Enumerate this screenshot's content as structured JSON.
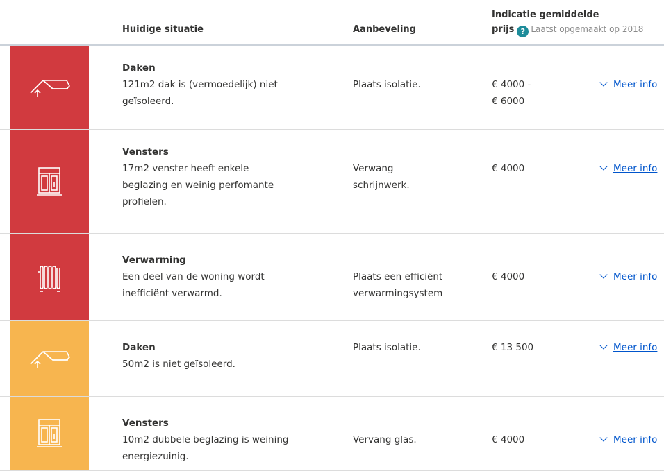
{
  "header": {
    "situatie": "Huidige situatie",
    "aanbeveling": "Aanbeveling",
    "prijs_line1": "Indicatie gemiddelde",
    "prijs_line2": "prijs",
    "help_glyph": "?",
    "updated": "Laatst opgemaakt op 2018"
  },
  "colors": {
    "red": "#d13a3f",
    "orange": "#f7b54f",
    "link": "#0055cc",
    "help": "#1d8c9a"
  },
  "rows": [
    {
      "severity": "red",
      "icon": "roof-icon",
      "title": "Daken",
      "desc_lines": [
        "121m2 dak is (vermoedelijk) niet",
        "geïsoleerd."
      ],
      "rec_lines": [
        "Plaats isolatie."
      ],
      "price_lines": [
        "€ 4000 -",
        "€ 6000"
      ],
      "more": "Meer info"
    },
    {
      "severity": "red",
      "icon": "window-icon",
      "title": "Vensters",
      "desc_lines": [
        "17m2 venster heeft enkele",
        "beglazing en weinig perfomante",
        "profielen."
      ],
      "rec_lines": [
        "Verwang",
        "schrijnwerk."
      ],
      "price_lines": [
        "€ 4000"
      ],
      "more": "Meer info"
    },
    {
      "severity": "red",
      "icon": "radiator-icon",
      "title": "Verwarming",
      "desc_lines": [
        "Een deel van de woning wordt",
        "inefficiënt verwarmd."
      ],
      "rec_lines": [
        "Plaats een efficiënt",
        "verwarmingsystem"
      ],
      "price_lines": [
        "€ 4000"
      ],
      "more": "Meer info"
    },
    {
      "severity": "orange",
      "icon": "roof-icon",
      "title": "Daken",
      "desc_lines": [
        "50m2 is niet geïsoleerd."
      ],
      "rec_lines": [
        "Plaats isolatie."
      ],
      "price_lines": [
        "€ 13 500"
      ],
      "more": "Meer info"
    },
    {
      "severity": "orange",
      "icon": "window-icon",
      "title": "Vensters",
      "desc_lines": [
        "10m2 dubbele beglazing is weining",
        "energiezuinig."
      ],
      "rec_lines": [
        "Vervang glas."
      ],
      "price_lines": [
        "€ 4000"
      ],
      "more": "Meer info"
    }
  ]
}
